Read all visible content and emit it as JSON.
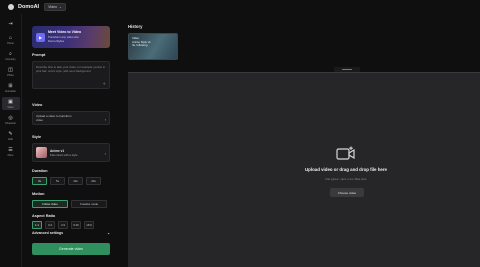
{
  "app": {
    "name": "DomoAI",
    "version": "Video",
    "version_chevron": "⌄"
  },
  "rail": [
    {
      "glyph": "⇥",
      "label": "",
      "icon": "collapse-icon"
    },
    {
      "glyph": "⌂",
      "label": "Home",
      "icon": "home-icon"
    },
    {
      "glyph": "⌕",
      "label": "Inventory",
      "icon": "search-icon"
    },
    {
      "glyph": "◫",
      "label": "Photo",
      "icon": "image-icon"
    },
    {
      "glyph": "⊞",
      "label": "Animation",
      "icon": "grid-icon"
    },
    {
      "glyph": "▣",
      "label": "Video",
      "icon": "video-icon",
      "active": true
    },
    {
      "glyph": "◎",
      "label": "Character",
      "icon": "character-icon"
    },
    {
      "glyph": "✎",
      "label": "Edit",
      "icon": "edit-icon"
    },
    {
      "glyph": "☰",
      "label": "More",
      "icon": "more-icon"
    }
  ],
  "promo": {
    "title": "Meet Video to Video",
    "line2": "Transform any video into",
    "line3": "Domo-Styles"
  },
  "prompt": {
    "label": "Prompt",
    "placeholder": "Describe how to alter your video, for example: person in pink hair, comic style, with neon background"
  },
  "video": {
    "label": "Video",
    "line1": "Upload a video to transform",
    "line2": "video"
  },
  "style": {
    "label": "Style",
    "name": "Anime v1",
    "desc": "Flat colors with a style"
  },
  "duration": {
    "label": "Duration",
    "options": [
      "3s",
      "5s",
      "10s",
      "20s"
    ],
    "selected": 0
  },
  "motion": {
    "label": "Motion",
    "options": [
      "Follow video",
      "Creative mode"
    ],
    "selected": 0
  },
  "aspect": {
    "label": "Aspect Ratio",
    "options": [
      "1:1",
      "3:4",
      "4:3",
      "9:16",
      "16:9"
    ],
    "selected": 0
  },
  "advanced": {
    "label": "Advanced settings",
    "chevron": "⌄"
  },
  "generate": {
    "label": "Generate video"
  },
  "history": {
    "label": "History",
    "line1": "Video",
    "line2": "Anime Style v1",
    "line3": "3s, following"
  },
  "upload": {
    "title": "Upload video or drag and drop file here",
    "subtitle": "File types: mp4, mov. Max size",
    "button": "Choose video"
  },
  "colors": {
    "accent": "#2f8f5e",
    "background": "#0f0f10",
    "canvas": "#262628",
    "promo_icon": "#6f6cf2"
  }
}
